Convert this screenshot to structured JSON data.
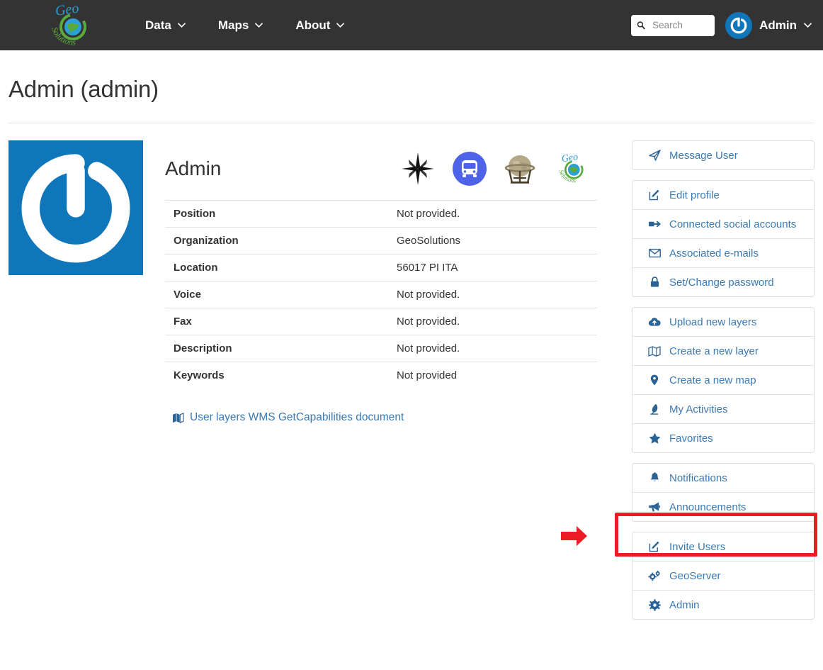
{
  "navbar": {
    "brand_name": "GeoSolutions",
    "brand_top_text": "Geo",
    "brand_bottom_text": "Solutions",
    "menu": [
      {
        "label": "Data",
        "icon": "chevron-down-icon"
      },
      {
        "label": "Maps",
        "icon": "chevron-down-icon"
      },
      {
        "label": "About",
        "icon": "chevron-down-icon"
      }
    ],
    "search": {
      "value": "",
      "placeholder": "Search",
      "icon": "search-icon"
    },
    "user": {
      "name": "Admin",
      "avatar_icon": "geonode-logo-icon",
      "caret_icon": "chevron-down-icon"
    },
    "background_color": "#333333"
  },
  "page": {
    "title": "Admin (admin)"
  },
  "profile": {
    "avatar_icon": "geonode-logo-icon",
    "avatar_background": "#1076ba",
    "display_name": "Admin",
    "social_icons": [
      {
        "name": "compass-rose-icon",
        "title": "Compass"
      },
      {
        "name": "bus-icon",
        "title": "Bus"
      },
      {
        "name": "globe-stand-icon",
        "title": "Globe"
      },
      {
        "name": "geosolutions-logo-icon",
        "title": "GeoSolutions"
      }
    ],
    "fields": [
      {
        "label": "Position",
        "value": "Not provided."
      },
      {
        "label": "Organization",
        "value": "GeoSolutions"
      },
      {
        "label": "Location",
        "value": "56017 PI ITA"
      },
      {
        "label": "Voice",
        "value": "Not provided."
      },
      {
        "label": "Fax",
        "value": "Not provided."
      },
      {
        "label": "Description",
        "value": "Not provided."
      },
      {
        "label": "Keywords",
        "value": "Not provided"
      }
    ],
    "wms_link": {
      "label": "User layers WMS GetCapabilities document",
      "icon": "map-icon"
    }
  },
  "sidebar": {
    "link_color": "#3a7ab3",
    "groups": [
      {
        "items": [
          {
            "label": "Message User",
            "icon": "paper-plane-icon"
          }
        ]
      },
      {
        "items": [
          {
            "label": "Edit profile",
            "icon": "edit-square-icon"
          },
          {
            "label": "Connected social accounts",
            "icon": "sign-in-icon"
          },
          {
            "label": "Associated e-mails",
            "icon": "envelope-icon"
          },
          {
            "label": "Set/Change password",
            "icon": "lock-icon"
          }
        ]
      },
      {
        "items": [
          {
            "label": "Upload new layers",
            "icon": "cloud-upload-icon"
          },
          {
            "label": "Create a new layer",
            "icon": "map-folded-icon"
          },
          {
            "label": "Create a new map",
            "icon": "map-marker-icon"
          },
          {
            "label": "My Activities",
            "icon": "feather-icon"
          },
          {
            "label": "Favorites",
            "icon": "star-icon"
          }
        ]
      },
      {
        "items": [
          {
            "label": "Notifications",
            "icon": "bell-icon"
          },
          {
            "label": "Announcements",
            "icon": "bullhorn-icon"
          }
        ]
      },
      {
        "items": [
          {
            "label": "Invite Users",
            "icon": "edit-square-icon"
          },
          {
            "label": "GeoServer",
            "icon": "cogs-icon"
          },
          {
            "label": "Admin",
            "icon": "gear-icon"
          }
        ]
      }
    ]
  },
  "annotation": {
    "highlight_color": "#ec1c24",
    "highlight_target": "Announcements",
    "arrow_icon": "right-arrow-icon"
  }
}
